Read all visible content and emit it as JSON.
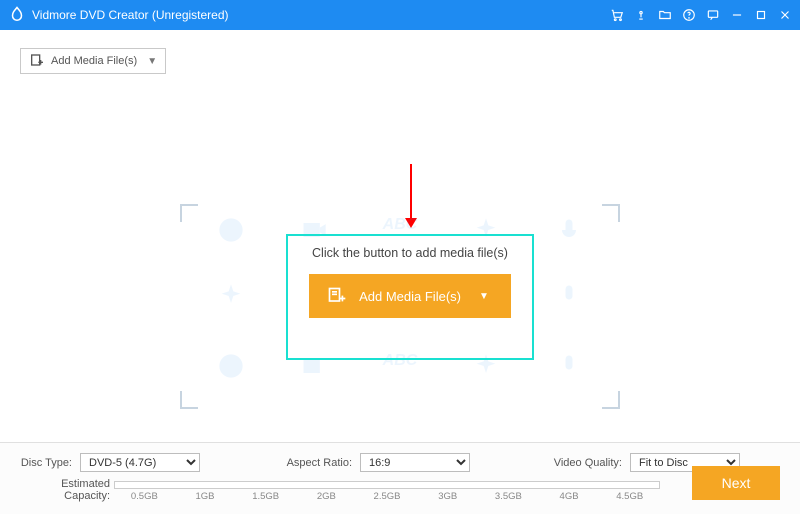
{
  "titlebar": {
    "app_name": "Vidmore DVD Creator (Unregistered)"
  },
  "toolbar": {
    "add_media_label": "Add Media File(s)"
  },
  "drop": {
    "hint": "Click the button to add media file(s)",
    "button_label": "Add Media File(s)",
    "bg_word": "ABC"
  },
  "bottom": {
    "disc_type_label": "Disc Type:",
    "disc_type_value": "DVD-5 (4.7G)",
    "aspect_label": "Aspect Ratio:",
    "aspect_value": "16:9",
    "quality_label": "Video Quality:",
    "quality_value": "Fit to Disc",
    "capacity_label": "Estimated Capacity:",
    "ticks": [
      "0.5GB",
      "1GB",
      "1.5GB",
      "2GB",
      "2.5GB",
      "3GB",
      "3.5GB",
      "4GB",
      "4.5GB"
    ],
    "next_label": "Next"
  }
}
